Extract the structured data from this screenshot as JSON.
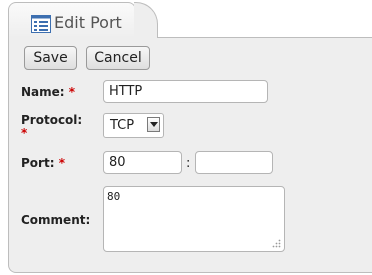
{
  "tab": {
    "title": "Edit Port",
    "icon": "list-window-icon"
  },
  "toolbar": {
    "save_label": "Save",
    "cancel_label": "Cancel"
  },
  "form": {
    "name": {
      "label": "Name:",
      "required_mark": "*",
      "value": "HTTP"
    },
    "protocol": {
      "label": "Protocol:",
      "required_mark": "*",
      "selected": "TCP"
    },
    "port": {
      "label": "Port:",
      "required_mark": "*",
      "start_value": "80",
      "separator": ":",
      "end_value": ""
    },
    "comment": {
      "label": "Comment:",
      "value": "80"
    }
  },
  "colors": {
    "required": "#cc0000",
    "panel_background": "#eeeeee",
    "border": "#bdbdbd"
  }
}
